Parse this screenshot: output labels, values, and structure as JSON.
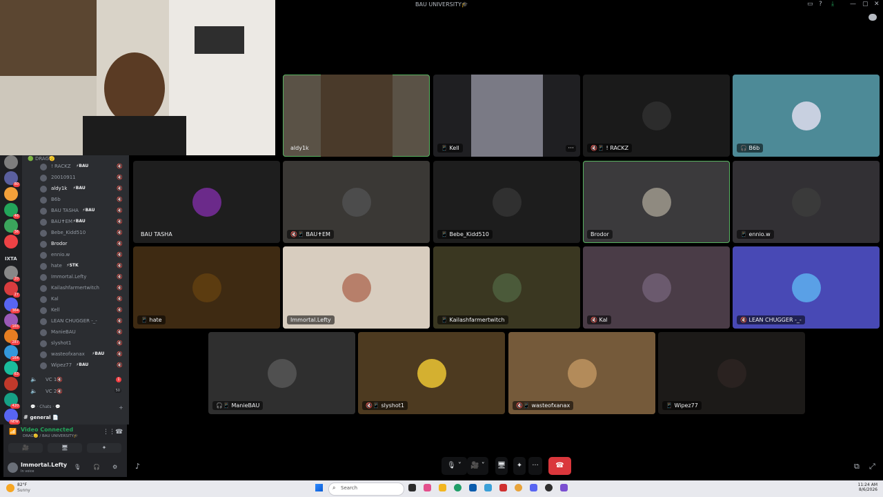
{
  "window": {
    "title": "BAU UNIVERSITY🎓"
  },
  "servers": [
    {
      "badge": ""
    },
    {
      "badge": "80"
    },
    {
      "badge": ""
    },
    {
      "badge": "46"
    },
    {
      "badge": "36"
    },
    {
      "badge": ""
    },
    {
      "badge": "20"
    },
    {
      "badge": "27"
    },
    {
      "badge": "364"
    },
    {
      "badge": "165"
    },
    {
      "badge": "287"
    },
    {
      "badge": "164"
    },
    {
      "badge": "63"
    },
    {
      "badge": ""
    },
    {
      "badge": "420"
    },
    {
      "badge": "NEW"
    }
  ],
  "server_text": "IXTA",
  "channel_group": "DRAG🫡",
  "members": [
    {
      "name": "! RACKZ",
      "tag": "⚡BAU",
      "highlight": false
    },
    {
      "name": "20010911",
      "tag": "",
      "highlight": false
    },
    {
      "name": "aldy1k",
      "tag": "⚡BAU",
      "highlight": true
    },
    {
      "name": "B6b",
      "tag": "",
      "highlight": false
    },
    {
      "name": "BAU TASHA",
      "tag": "⚡BAU",
      "highlight": false
    },
    {
      "name": "BAU✝EM",
      "tag": "⚡BAU",
      "highlight": false
    },
    {
      "name": "Bebe_Kidd510",
      "tag": "",
      "highlight": false
    },
    {
      "name": "Brodor",
      "tag": "",
      "highlight": true
    },
    {
      "name": "ennio.w",
      "tag": "",
      "highlight": false
    },
    {
      "name": "hate",
      "tag": "⚡STK",
      "highlight": false
    },
    {
      "name": "Immortal.Lefty",
      "tag": "",
      "highlight": false
    },
    {
      "name": "Kailashfarmertwitch",
      "tag": "",
      "highlight": false
    },
    {
      "name": "Kal",
      "tag": "",
      "highlight": false
    },
    {
      "name": "Kell",
      "tag": "",
      "highlight": false
    },
    {
      "name": "LEAN CHUGGER -_-",
      "tag": "",
      "highlight": false
    },
    {
      "name": "ManieBAU",
      "tag": "",
      "highlight": false
    },
    {
      "name": "slyshot1",
      "tag": "",
      "highlight": false
    },
    {
      "name": "wasteofxanax",
      "tag": "⚡BAU",
      "highlight": false
    },
    {
      "name": "Wipez77",
      "tag": "⚡BAU",
      "highlight": false
    }
  ],
  "voice_channels": [
    {
      "name": "VC 1🔇",
      "badge": "1",
      "count": ""
    },
    {
      "name": "VC 2🔇",
      "badge": "",
      "count": "50"
    }
  ],
  "chats_header": "Chats",
  "text_channel": "general 📄",
  "connection": {
    "status": "Video Connected",
    "location": "DRAG🫡 / BAU UNIVERSITY🎓"
  },
  "user": {
    "name": "Immortal.Lefty",
    "status": "In voice"
  },
  "tiles": [
    {
      "name": "aldy1k",
      "device": "",
      "bg": "#5a5246",
      "avatar": "#4a3a2a",
      "selected": true,
      "plain": true,
      "dots": false,
      "video": true
    },
    {
      "name": "Kell",
      "device": "📱",
      "bg": "#1f1f22",
      "avatar": "#7a7a85",
      "selected": false,
      "plain": false,
      "dots": true,
      "video": true
    },
    {
      "name": "! RACKZ",
      "device": "🔇📱",
      "bg": "#1a1a1a",
      "avatar": "#2c2c2c",
      "selected": false,
      "plain": false,
      "dots": false,
      "video": false
    },
    {
      "name": "B6b",
      "device": "🎧",
      "bg": "#4d8a97",
      "avatar": "#c8d0e0",
      "selected": false,
      "plain": false,
      "dots": false,
      "video": false
    },
    {
      "name": "BAU TASHA",
      "device": "",
      "bg": "#1e1e1e",
      "avatar": "#6b2a8a",
      "selected": false,
      "plain": true,
      "dots": false,
      "video": false
    },
    {
      "name": "BAU✝EM",
      "device": "🔇📱",
      "bg": "#3a3835",
      "avatar": "#4c4c4c",
      "selected": false,
      "plain": false,
      "dots": false,
      "video": false
    },
    {
      "name": "Bebe_Kidd510",
      "device": "📱",
      "bg": "#1d1d1d",
      "avatar": "#303030",
      "selected": false,
      "plain": false,
      "dots": false,
      "video": false
    },
    {
      "name": "Brodor",
      "device": "",
      "bg": "#3b3a3c",
      "avatar": "#8f8a80",
      "selected": true,
      "plain": false,
      "dots": false,
      "video": false
    },
    {
      "name": "ennio.w",
      "device": "📱",
      "bg": "#323034",
      "avatar": "#3a3a3a",
      "selected": false,
      "plain": false,
      "dots": false,
      "video": false
    },
    {
      "name": "hate",
      "device": "📱",
      "bg": "#3e2a12",
      "avatar": "#5c3c10",
      "selected": false,
      "plain": false,
      "dots": false,
      "video": false
    },
    {
      "name": "Immortal.Lefty",
      "device": "",
      "bg": "#d8cdbf",
      "avatar": "#b77f6a",
      "selected": false,
      "plain": false,
      "dots": false,
      "video": false
    },
    {
      "name": "Kailashfarmertwitch",
      "device": "📱",
      "bg": "#3a3721",
      "avatar": "#4b5a3a",
      "selected": false,
      "plain": false,
      "dots": false,
      "video": false
    },
    {
      "name": "Kal",
      "device": "🔇",
      "bg": "#4a3c47",
      "avatar": "#6b5a6e",
      "selected": false,
      "plain": false,
      "dots": false,
      "video": false
    },
    {
      "name": "LEAN CHUGGER -_-",
      "device": "🔇",
      "bg": "#4849b5",
      "avatar": "#5aa0e6",
      "selected": false,
      "plain": false,
      "dots": false,
      "video": false
    },
    {
      "name": "ManieBAU",
      "device": "🎧📱",
      "bg": "#2f2f2f",
      "avatar": "#505050",
      "selected": false,
      "plain": false,
      "dots": false,
      "video": false
    },
    {
      "name": "slyshot1",
      "device": "🔇📱",
      "bg": "#4d3a20",
      "avatar": "#d4b030",
      "selected": false,
      "plain": false,
      "dots": false,
      "video": false
    },
    {
      "name": "wasteofxanax",
      "device": "🔇📱",
      "bg": "#755a3a",
      "avatar": "#b38b5a",
      "selected": false,
      "plain": false,
      "dots": false,
      "video": false
    },
    {
      "name": "Wipez77",
      "device": "📱",
      "bg": "#1c1a18",
      "avatar": "#2a2220",
      "selected": false,
      "plain": false,
      "dots": false,
      "video": false
    }
  ],
  "controls": {
    "mic": "🎙",
    "video": "🎥",
    "share": "🖥",
    "activity": "✦",
    "more": "···",
    "hangup": "☎"
  },
  "taskbar": {
    "weather_temp": "82°F",
    "weather_desc": "Sunny",
    "search_placeholder": "Search",
    "time": "11:24 AM",
    "date": "8/6/2026"
  },
  "colors": {
    "accent_green": "#23a55a",
    "danger": "#da373c",
    "selected_outline": "#57b360"
  }
}
